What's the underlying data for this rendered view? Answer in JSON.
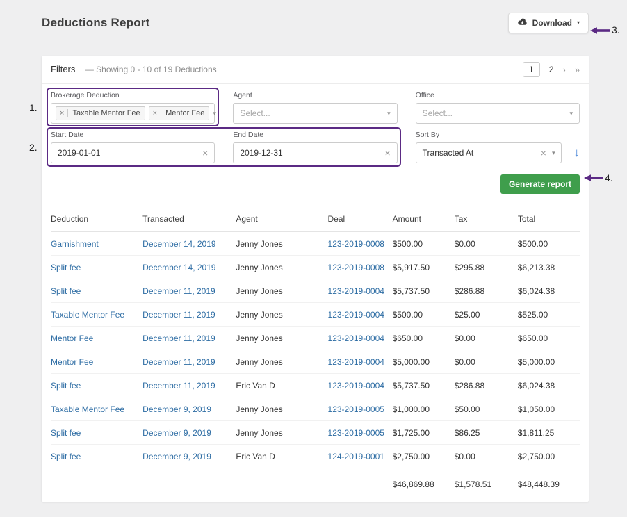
{
  "colors": {
    "annotation_purple": "#5b2a84",
    "button_green": "#3f9e4c",
    "link_blue": "#2e6da4",
    "sort_arrow_blue": "#3b7cd5"
  },
  "page": {
    "title": "Deductions Report"
  },
  "header": {
    "download_label": "Download",
    "caret": "▾"
  },
  "annotations": {
    "n1": "1.",
    "n2": "2.",
    "n3": "3.",
    "n4": "4."
  },
  "filters": {
    "title": "Filters",
    "summary": "—  Showing 0 - 10 of 19 Deductions",
    "pagination": [
      "1",
      "2",
      "›",
      "»"
    ],
    "brokerage_deduction": {
      "label": "Brokerage Deduction",
      "tags": [
        "Taxable Mentor Fee",
        "Mentor Fee"
      ],
      "tag_remove": "×",
      "caret": "▾"
    },
    "agent": {
      "label": "Agent",
      "placeholder": "Select...",
      "caret": "▾"
    },
    "office": {
      "label": "Office",
      "placeholder": "Select...",
      "caret": "▾"
    },
    "start_date": {
      "label": "Start Date",
      "value": "2019-01-01",
      "clear": "×"
    },
    "end_date": {
      "label": "End Date",
      "value": "2019-12-31",
      "clear": "×"
    },
    "sort_by": {
      "label": "Sort By",
      "value": "Transacted At",
      "clear": "×",
      "caret": "▾"
    },
    "sort_direction": "↓",
    "generate_label": "Generate report"
  },
  "table": {
    "headers": [
      "Deduction",
      "Transacted",
      "Agent",
      "Deal",
      "Amount",
      "Tax",
      "Total"
    ],
    "rows": [
      {
        "deduction": "Garnishment",
        "transacted": "December 14, 2019",
        "agent": "Jenny Jones",
        "deal": "123-2019-0008",
        "amount": "$500.00",
        "tax": "$0.00",
        "total": "$500.00"
      },
      {
        "deduction": "Split fee",
        "transacted": "December 14, 2019",
        "agent": "Jenny Jones",
        "deal": "123-2019-0008",
        "amount": "$5,917.50",
        "tax": "$295.88",
        "total": "$6,213.38"
      },
      {
        "deduction": "Split fee",
        "transacted": "December 11, 2019",
        "agent": "Jenny Jones",
        "deal": "123-2019-0004",
        "amount": "$5,737.50",
        "tax": "$286.88",
        "total": "$6,024.38"
      },
      {
        "deduction": "Taxable Mentor Fee",
        "transacted": "December 11, 2019",
        "agent": "Jenny Jones",
        "deal": "123-2019-0004",
        "amount": "$500.00",
        "tax": "$25.00",
        "total": "$525.00"
      },
      {
        "deduction": "Mentor Fee",
        "transacted": "December 11, 2019",
        "agent": "Jenny Jones",
        "deal": "123-2019-0004",
        "amount": "$650.00",
        "tax": "$0.00",
        "total": "$650.00"
      },
      {
        "deduction": "Mentor Fee",
        "transacted": "December 11, 2019",
        "agent": "Jenny Jones",
        "deal": "123-2019-0004",
        "amount": "$5,000.00",
        "tax": "$0.00",
        "total": "$5,000.00"
      },
      {
        "deduction": "Split fee",
        "transacted": "December 11, 2019",
        "agent": "Eric Van D",
        "deal": "123-2019-0004",
        "amount": "$5,737.50",
        "tax": "$286.88",
        "total": "$6,024.38"
      },
      {
        "deduction": "Taxable Mentor Fee",
        "transacted": "December 9, 2019",
        "agent": "Jenny Jones",
        "deal": "123-2019-0005",
        "amount": "$1,000.00",
        "tax": "$50.00",
        "total": "$1,050.00"
      },
      {
        "deduction": "Split fee",
        "transacted": "December 9, 2019",
        "agent": "Jenny Jones",
        "deal": "123-2019-0005",
        "amount": "$1,725.00",
        "tax": "$86.25",
        "total": "$1,811.25"
      },
      {
        "deduction": "Split fee",
        "transacted": "December 9, 2019",
        "agent": "Eric Van D",
        "deal": "124-2019-0001",
        "amount": "$2,750.00",
        "tax": "$0.00",
        "total": "$2,750.00"
      }
    ],
    "totals": {
      "amount": "$46,869.88",
      "tax": "$1,578.51",
      "total": "$48,448.39"
    }
  }
}
